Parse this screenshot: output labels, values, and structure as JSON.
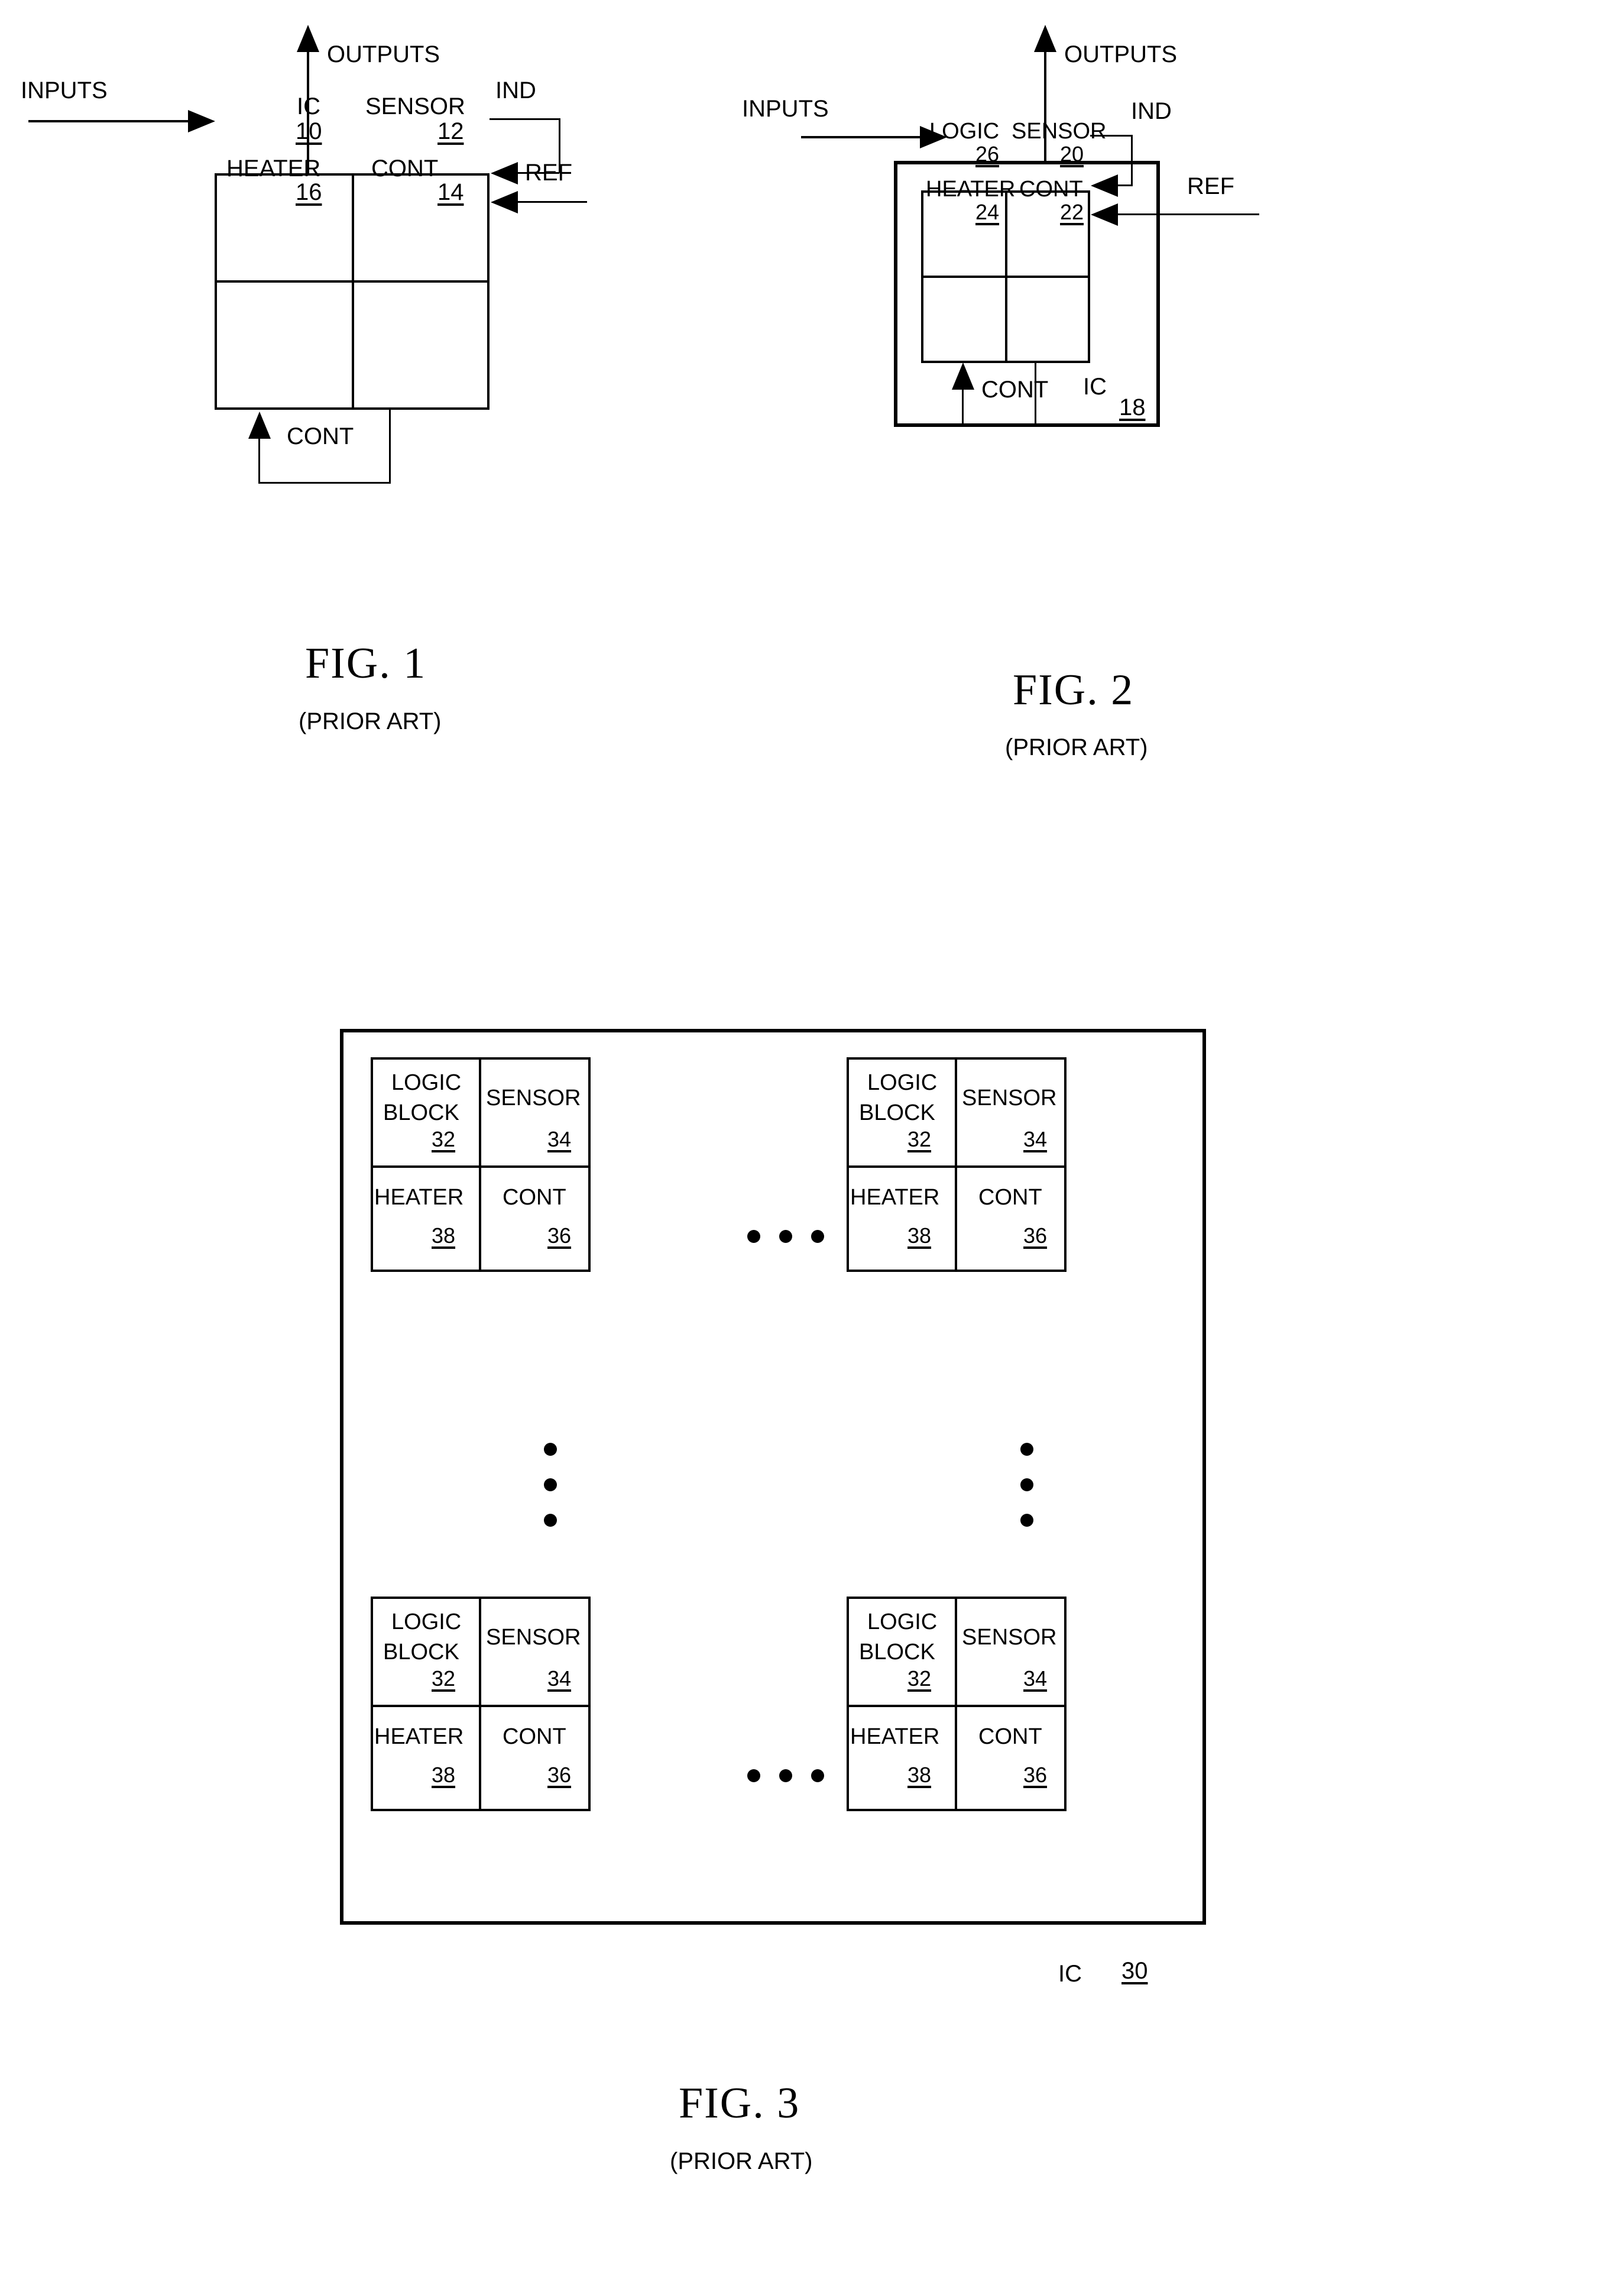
{
  "document": {
    "type": "patent-drawing-sheet",
    "figures": [
      "FIG. 1",
      "FIG. 2",
      "FIG. 3"
    ]
  },
  "fig1": {
    "caption": "FIG. 1",
    "subcaption": "(PRIOR ART)",
    "signals": {
      "inputs": "INPUTS",
      "outputs": "OUTPUTS",
      "ind": "IND",
      "ref": "REF",
      "cont_feedback": "CONT"
    },
    "blocks": [
      {
        "label": "IC",
        "ref": "10"
      },
      {
        "label": "SENSOR",
        "ref": "12"
      },
      {
        "label": "HEATER",
        "ref": "16"
      },
      {
        "label": "CONT",
        "ref": "14"
      }
    ]
  },
  "fig2": {
    "caption": "FIG. 2",
    "subcaption": "(PRIOR ART)",
    "signals": {
      "inputs": "INPUTS",
      "outputs": "OUTPUTS",
      "ind": "IND",
      "ref": "REF",
      "cont_feedback": "CONT"
    },
    "outer": {
      "label": "IC",
      "ref": "18"
    },
    "blocks": [
      {
        "label": "LOGIC",
        "ref": "26"
      },
      {
        "label": "SENSOR",
        "ref": "20"
      },
      {
        "label": "HEATER",
        "ref": "24"
      },
      {
        "label": "CONT",
        "ref": "22"
      }
    ]
  },
  "fig3": {
    "caption": "FIG. 3",
    "subcaption": "(PRIOR ART)",
    "outer": {
      "label": "IC",
      "ref": "30"
    },
    "cell_template": [
      {
        "label_line1": "LOGIC",
        "label_line2": "BLOCK",
        "ref": "32"
      },
      {
        "label": "SENSOR",
        "ref": "34"
      },
      {
        "label": "HEATER",
        "ref": "38"
      },
      {
        "label": "CONT",
        "ref": "36"
      }
    ],
    "tiles": [
      {
        "position": "top-left",
        "cells": [
          {
            "label_line1": "LOGIC",
            "label_line2": "BLOCK",
            "ref": "32"
          },
          {
            "label": "SENSOR",
            "ref": "34"
          },
          {
            "label": "HEATER",
            "ref": "38"
          },
          {
            "label": "CONT",
            "ref": "36"
          }
        ]
      },
      {
        "position": "top-right",
        "cells": [
          {
            "label_line1": "LOGIC",
            "label_line2": "BLOCK",
            "ref": "32"
          },
          {
            "label": "SENSOR",
            "ref": "34"
          },
          {
            "label": "HEATER",
            "ref": "38"
          },
          {
            "label": "CONT",
            "ref": "36"
          }
        ]
      },
      {
        "position": "bottom-left",
        "cells": [
          {
            "label_line1": "LOGIC",
            "label_line2": "BLOCK",
            "ref": "32"
          },
          {
            "label": "SENSOR",
            "ref": "34"
          },
          {
            "label": "HEATER",
            "ref": "38"
          },
          {
            "label": "CONT",
            "ref": "36"
          }
        ]
      },
      {
        "position": "bottom-right",
        "cells": [
          {
            "label_line1": "LOGIC",
            "label_line2": "BLOCK",
            "ref": "32"
          },
          {
            "label": "SENSOR",
            "ref": "34"
          },
          {
            "label": "HEATER",
            "ref": "38"
          },
          {
            "label": "CONT",
            "ref": "36"
          }
        ]
      }
    ],
    "ellipsis": {
      "horizontal_count": 3,
      "vertical_count": 3
    }
  },
  "colors": {
    "ink": "#000000",
    "paper": "#ffffff"
  }
}
